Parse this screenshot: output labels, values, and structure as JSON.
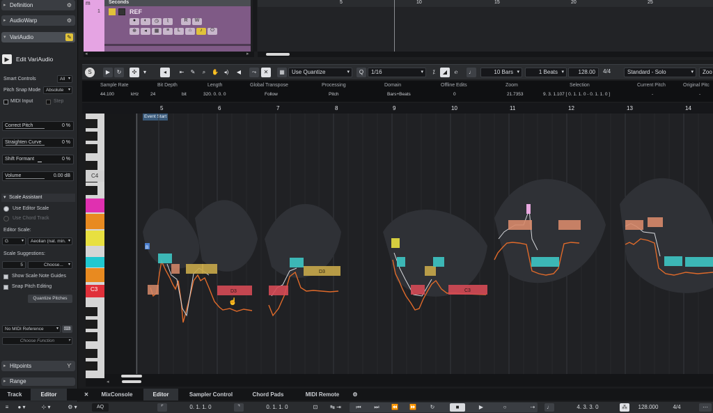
{
  "inspector": {
    "sections": [
      {
        "label": "Definition"
      },
      {
        "label": "AudioWarp"
      },
      {
        "label": "VariAudio"
      }
    ],
    "edit_variaudio": "Edit VariAudio",
    "smart_controls": {
      "label": "Smart Controls",
      "value": "All"
    },
    "pitch_snap_mode": {
      "label": "Pitch Snap Mode",
      "value": "Absolute"
    },
    "midi_input": "MIDI Input",
    "step": "Step",
    "correct_pitch": {
      "label": "Correct Pitch",
      "value": "0 %"
    },
    "straighten_curve": {
      "label": "Straighten Curve",
      "value": "0 %"
    },
    "shift_formant": {
      "label": "Shift Formant",
      "value": "0 %"
    },
    "volume": {
      "label": "Volume",
      "value": "0.00 dB"
    },
    "scale_assistant": "Scale Assistant",
    "use_editor_scale": "Use Editor Scale",
    "use_chord_track": "Use Chord Track",
    "editor_scale_label": "Editor Scale:",
    "editor_scale_root": "G",
    "editor_scale_mode": "Aeolian (nat. min.",
    "scale_suggestions_label": "Scale Suggestions:",
    "scale_suggestions_count": "5",
    "scale_suggestions_choose": "Choose...",
    "show_scale_note_guides": "Show Scale Note Guides",
    "snap_pitch_editing": "Snap Pitch Editing",
    "quantize_pitches": "Quantize Pitches",
    "no_midi_reference": "No MIDI Reference",
    "choose_function": "Choose Function",
    "hitpoints": "Hitpoints",
    "range": "Range"
  },
  "project": {
    "ruler_label": "Seconds",
    "track_number": "1",
    "track_name": "REF",
    "track_tag": "m",
    "ruler_numbers": [
      "5",
      "10",
      "15",
      "20",
      "25"
    ]
  },
  "toolbar": {
    "quantize_mode": "Use Quantize",
    "quantize_label": "Q",
    "quantize_value": "1/16",
    "length_bars": "10 Bars",
    "length_beats": "1 Beats",
    "tempo": "128.00",
    "signature": "4/4",
    "preset": "Standard - Solo",
    "zoom_cut": "Zoo"
  },
  "info": {
    "headers": [
      "Sample Rate",
      "Bit Depth",
      "Length",
      "Global Transpose",
      "Processing",
      "Domain",
      "Offline Edits",
      "Zoom",
      "Selection",
      "Current Pitch",
      "Original Pitc"
    ],
    "values": [
      "44.100",
      "kHz",
      "24",
      "bit",
      "320. 0. 0. 0",
      "Follow",
      "Pitch",
      "Bars+Beats",
      "0",
      "21.7353",
      "9. 3. 1.107 [ 0. 1. 1.  0 - 0. 1. 1.  0 ]",
      "-",
      "-"
    ]
  },
  "editor": {
    "ruler": [
      "5",
      "6",
      "7",
      "8",
      "9",
      "10",
      "11",
      "12",
      "13",
      "14"
    ],
    "event_start": "Event Start",
    "key_c4": "C4",
    "key_c3": "C3",
    "note_labels": [
      "D3",
      "D3",
      "C3"
    ],
    "small_marker": "B"
  },
  "tabs": [
    "Track",
    "Editor",
    "MixConsole",
    "Editor",
    "Sampler Control",
    "Chord Pads",
    "MIDI Remote"
  ],
  "transport": {
    "left_locator": "0. 1. 1.   0",
    "right_locator": "0. 1. 1.   0",
    "position": "4. 3. 3.   0",
    "tempo": "128.000",
    "signature": "4/4",
    "aq": "AQ"
  },
  "colors": {
    "accent_yellow": "#e0c23a",
    "note_teal": "#3ec6c4",
    "note_gold": "#c8a84a",
    "note_red": "#d54a55",
    "note_salmon": "#d78a6a",
    "pitch_curve": "#e06a2a",
    "track_purple": "#7f5a86",
    "key_c3_red": "#e0303a",
    "key_magenta": "#e030b0",
    "key_orange": "#e88a20",
    "key_yellow": "#e8e040",
    "key_cyan": "#20c8d0"
  }
}
